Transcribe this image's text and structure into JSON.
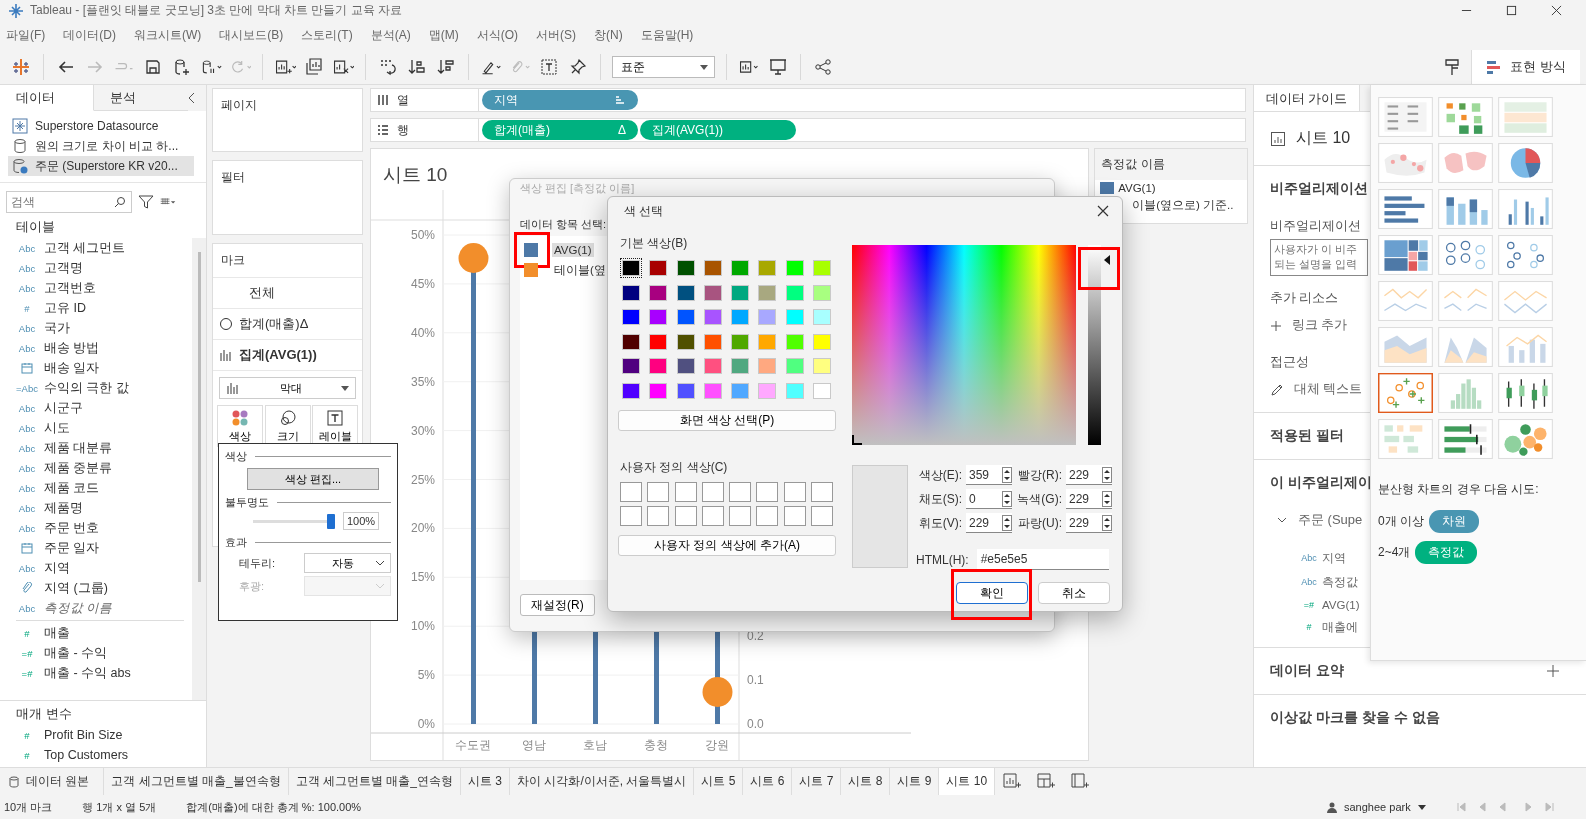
{
  "window": {
    "title": "Tableau - [플랜잇 태블로 굿모닝] 3초 만에 막대 차트 만들기 교육 자료"
  },
  "menu": [
    "파일(F)",
    "데이터(D)",
    "워크시트(W)",
    "대시보드(B)",
    "스토리(T)",
    "분석(A)",
    "맵(M)",
    "서식(O)",
    "서버(S)",
    "창(N)",
    "도움말(H)"
  ],
  "toolbar": {
    "fit_dropdown": "표준",
    "show_me_button": "표현 방식"
  },
  "data_pane": {
    "tabs": [
      {
        "label": "데이터",
        "selected": true
      },
      {
        "label": "분석",
        "selected": false
      }
    ],
    "sources": [
      {
        "kind": "extract",
        "label": "Superstore Datasource",
        "selected": false
      },
      {
        "kind": "database",
        "label": "원의 크기로 차이 비교 하...",
        "selected": false
      },
      {
        "kind": "primary",
        "label": "주문 (Superstore KR v20...",
        "selected": true
      }
    ],
    "search": {
      "placeholder": "검색"
    },
    "table_heading": "테이블",
    "fields": [
      {
        "kind": "badge",
        "badge": "Abc",
        "measure": false,
        "name": "고객 세그먼트",
        "italic": false
      },
      {
        "kind": "badge",
        "badge": "Abc",
        "measure": false,
        "name": "고객명",
        "italic": false
      },
      {
        "kind": "badge",
        "badge": "Abc",
        "measure": false,
        "name": "고객번호",
        "italic": false
      },
      {
        "kind": "badge",
        "badge": "#",
        "measure": false,
        "name": "고유 ID",
        "italic": false
      },
      {
        "kind": "badge",
        "badge": "Abc",
        "measure": false,
        "name": "국가",
        "italic": false
      },
      {
        "kind": "badge",
        "badge": "Abc",
        "measure": false,
        "name": "배송 방법",
        "italic": false
      },
      {
        "kind": "date",
        "measure": false,
        "name": "배송 일자",
        "italic": false
      },
      {
        "kind": "badge",
        "badge": "=Abc",
        "measure": false,
        "name": "수익의 극한 값",
        "italic": false
      },
      {
        "kind": "badge",
        "badge": "Abc",
        "measure": false,
        "name": "시군구",
        "italic": false
      },
      {
        "kind": "badge",
        "badge": "Abc",
        "measure": false,
        "name": "시도",
        "italic": false
      },
      {
        "kind": "badge",
        "badge": "Abc",
        "measure": false,
        "name": "제품 대분류",
        "italic": false
      },
      {
        "kind": "badge",
        "badge": "Abc",
        "measure": false,
        "name": "제품 중분류",
        "italic": false
      },
      {
        "kind": "badge",
        "badge": "Abc",
        "measure": false,
        "name": "제품 코드",
        "italic": false
      },
      {
        "kind": "badge",
        "badge": "Abc",
        "measure": false,
        "name": "제품명",
        "italic": false
      },
      {
        "kind": "badge",
        "badge": "Abc",
        "measure": false,
        "name": "주문 번호",
        "italic": false
      },
      {
        "kind": "date",
        "measure": false,
        "name": "주문 일자",
        "italic": false
      },
      {
        "kind": "badge",
        "badge": "Abc",
        "measure": false,
        "name": "지역",
        "italic": false
      },
      {
        "kind": "group",
        "measure": false,
        "name": "지역 (그룹)",
        "italic": false
      },
      {
        "kind": "badge",
        "badge": "Abc",
        "measure": false,
        "name": "측정값 이름",
        "italic": true
      }
    ],
    "measures": [
      {
        "kind": "badge",
        "badge": "#",
        "measure": true,
        "name": "매출",
        "italic": false
      },
      {
        "kind": "badge",
        "badge": "=#",
        "measure": true,
        "name": "매출 - 수익",
        "italic": false
      },
      {
        "kind": "badge",
        "badge": "=#",
        "measure": true,
        "name": "매출 - 수익 abs",
        "italic": false
      }
    ],
    "parameters_heading": "매개 변수",
    "parameters": [
      {
        "kind": "badge",
        "badge": "#",
        "measure": true,
        "name": "Profit Bin Size",
        "italic": false
      },
      {
        "kind": "badge",
        "badge": "#",
        "measure": true,
        "name": "Top Customers",
        "italic": false
      }
    ]
  },
  "shelves": {
    "pages": "페이지",
    "filters": "필터",
    "marks": {
      "title": "마크",
      "all": "전체",
      "layers": [
        {
          "kind": "circle",
          "label": "합계(매출)",
          "suffix": "Δ",
          "selected": false
        },
        {
          "kind": "bar",
          "label": "집계(AVG(1))",
          "selected": true
        }
      ],
      "mark_type": "막대",
      "buttons": [
        {
          "kind": "color",
          "label": "색상"
        },
        {
          "kind": "size",
          "label": "크기"
        },
        {
          "kind": "label",
          "label": "레이블"
        }
      ]
    }
  },
  "color_popup": {
    "section": "색상",
    "edit_button": "색상 편집...",
    "opacity_label": "불투명도",
    "level": 1.0,
    "opacity_value": "100%",
    "effects_label": "효과",
    "border_label": "테두리:",
    "border_value": "자동",
    "halo_label": "후광:",
    "halo_disabled": true
  },
  "columns_shelf": {
    "label": "열",
    "pills": [
      {
        "label": "지역",
        "color": "#4996b2",
        "sorted": true
      }
    ]
  },
  "rows_shelf": {
    "label": "행",
    "pills": [
      {
        "label": "합계(매출)",
        "color": "#00b180",
        "marker": "Δ"
      },
      {
        "label": "집계(AVG(1))",
        "color": "#00b180"
      }
    ]
  },
  "sheet": {
    "title": "시트 10",
    "y_ticks": [
      "50%",
      "45%",
      "40%",
      "35%",
      "30%",
      "25%",
      "20%",
      "15%",
      "10%",
      "5%",
      "0%"
    ],
    "right_ticks": [
      "0.2",
      "0.1",
      "0.0"
    ],
    "categories": [
      "수도권",
      "영남",
      "호남",
      "충청",
      "강원"
    ]
  },
  "legend": {
    "title": "측정값 이름",
    "items": [
      {
        "label": "AVG(1)",
        "color": "#4e79a7"
      },
      {
        "label": "이블(옆으로) 기준.."
      }
    ]
  },
  "edit_color_dialog": {
    "title": "색상 편집 [측정값 이름]",
    "list_label": "데이터 항목 선택:",
    "items": [
      {
        "label": "AVG(1)",
        "color": "#4e79a7",
        "selected": true,
        "highlighted": true
      },
      {
        "label": "테이블(옆",
        "color": "#f28e2b",
        "selected": false,
        "highlighted": false
      }
    ],
    "reset_button": "재설정(R)"
  },
  "color_picker": {
    "title": "색 선택",
    "basic_label": "기본 색상(B)",
    "swatches": [
      {
        "color": "#000000",
        "selected": true
      },
      {
        "color": "#a80000",
        "selected": false
      },
      {
        "color": "#005000",
        "selected": false
      },
      {
        "color": "#a85400",
        "selected": false
      },
      {
        "color": "#00a800",
        "selected": false
      },
      {
        "color": "#a8a800",
        "selected": false
      },
      {
        "color": "#00ff00",
        "selected": false
      },
      {
        "color": "#a8ff00",
        "selected": false
      },
      {
        "color": "#000080",
        "selected": false
      },
      {
        "color": "#a80080",
        "selected": false
      },
      {
        "color": "#005080",
        "selected": false
      },
      {
        "color": "#a85480",
        "selected": false
      },
      {
        "color": "#00a880",
        "selected": false
      },
      {
        "color": "#a8a880",
        "selected": false
      },
      {
        "color": "#00ff80",
        "selected": false
      },
      {
        "color": "#a8ff80",
        "selected": false
      },
      {
        "color": "#0000ff",
        "selected": false
      },
      {
        "color": "#a800ff",
        "selected": false
      },
      {
        "color": "#0054ff",
        "selected": false
      },
      {
        "color": "#a854ff",
        "selected": false
      },
      {
        "color": "#00a8ff",
        "selected": false
      },
      {
        "color": "#a8a8ff",
        "selected": false
      },
      {
        "color": "#00ffff",
        "selected": false
      },
      {
        "color": "#a8ffff",
        "selected": false
      },
      {
        "color": "#500000",
        "selected": false
      },
      {
        "color": "#ff0000",
        "selected": false
      },
      {
        "color": "#505000",
        "selected": false
      },
      {
        "color": "#ff5000",
        "selected": false
      },
      {
        "color": "#50a800",
        "selected": false
      },
      {
        "color": "#ffa800",
        "selected": false
      },
      {
        "color": "#50ff00",
        "selected": false
      },
      {
        "color": "#ffff00",
        "selected": false
      },
      {
        "color": "#500080",
        "selected": false
      },
      {
        "color": "#ff0080",
        "selected": false
      },
      {
        "color": "#505080",
        "selected": false
      },
      {
        "color": "#ff5080",
        "selected": false
      },
      {
        "color": "#50a880",
        "selected": false
      },
      {
        "color": "#ffa880",
        "selected": false
      },
      {
        "color": "#50ff80",
        "selected": false
      },
      {
        "color": "#ffff80",
        "selected": false
      },
      {
        "color": "#5000ff",
        "selected": false
      },
      {
        "color": "#ff00ff",
        "selected": false
      },
      {
        "color": "#5050ff",
        "selected": false
      },
      {
        "color": "#ff50ff",
        "selected": false
      },
      {
        "color": "#50a8ff",
        "selected": false
      },
      {
        "color": "#ffa8ff",
        "selected": false
      },
      {
        "color": "#50ffff",
        "selected": false
      },
      {
        "color": "#ffffff",
        "selected": false
      }
    ],
    "pick_button": "화면 색상 선택(P)",
    "custom_label": "사용자 정의 색상(C)",
    "add_button": "사용자 정의 색상에 추가(A)",
    "luminance": {
      "level": 0.95,
      "highlighted": true
    },
    "fields": [
      {
        "label": "색상(E):",
        "value": "359"
      },
      {
        "label": "빨강(R):",
        "value": "229"
      },
      {
        "label": "채도(S):",
        "value": "0"
      },
      {
        "label": "녹색(G):",
        "value": "229"
      },
      {
        "label": "휘도(V):",
        "value": "229"
      },
      {
        "label": "파랑(U):",
        "value": "229"
      }
    ],
    "html_label": "HTML(H):",
    "html_value": "#e5e5e5",
    "ok_button": "확인",
    "ok_highlighted": true,
    "cancel_button": "취소"
  },
  "data_guide": {
    "tab": "데이터 가이드",
    "sheet": "시트 10",
    "viz_heading": "비주얼리제이션",
    "desc_label": "비주얼리제이션",
    "desc_placeholder": "사용자가 이 비주\n되는 설명을 입력",
    "resources": "추가 리소스",
    "add_link": "링크 추가",
    "accessibility": "접근성",
    "alt_text": "대체 텍스트",
    "filters": "적용된 필터",
    "fields_heading": "이 비주얼리제이",
    "tree": {
      "label": "주문 (Supe",
      "expanded": true,
      "children": [
        {
          "kind": "badge",
          "badge": "Abc",
          "measure": false,
          "name": "지역"
        },
        {
          "kind": "badge",
          "badge": "Abc",
          "measure": false,
          "name": "측정값"
        },
        {
          "kind": "badge",
          "badge": "=#",
          "measure": true,
          "name": "AVG(1)"
        },
        {
          "kind": "badge",
          "badge": "#",
          "measure": true,
          "name": "매출에"
        }
      ]
    },
    "summary": "데이터 요약",
    "outliers": "이상값 마크를 찾을 수 없음"
  },
  "show_me": {
    "thumbnails": [
      {
        "kind": "text-table",
        "selected": false
      },
      {
        "kind": "heat-map",
        "selected": false
      },
      {
        "kind": "highlight-table",
        "selected": false
      },
      {
        "kind": "symbol-map",
        "selected": false
      },
      {
        "kind": "filled-map",
        "selected": false
      },
      {
        "kind": "pie",
        "selected": false
      },
      {
        "kind": "hbar",
        "selected": false
      },
      {
        "kind": "stacked-bar",
        "selected": false
      },
      {
        "kind": "side-bar",
        "selected": false
      },
      {
        "kind": "treemap",
        "selected": false
      },
      {
        "kind": "circles",
        "selected": false
      },
      {
        "kind": "side-circles",
        "selected": false
      },
      {
        "kind": "line",
        "selected": false
      },
      {
        "kind": "line-split",
        "selected": false
      },
      {
        "kind": "dual-line",
        "selected": false
      },
      {
        "kind": "area",
        "selected": false
      },
      {
        "kind": "area-split",
        "selected": false
      },
      {
        "kind": "combo",
        "selected": false
      },
      {
        "kind": "scatter",
        "selected": true
      },
      {
        "kind": "histogram",
        "selected": false
      },
      {
        "kind": "box-plot",
        "selected": false
      },
      {
        "kind": "gantt",
        "selected": false
      },
      {
        "kind": "bullet",
        "selected": false
      },
      {
        "kind": "bubbles",
        "selected": false
      }
    ],
    "hint": "분산형 차트의 경우 다음 시도:",
    "requirements": [
      {
        "count": "0개 이상",
        "pill": "차원",
        "color": "#4996b2"
      },
      {
        "count": "2~4개",
        "pill": "측정값",
        "color": "#00b180"
      }
    ]
  },
  "sheet_tabs": {
    "data_source": "데이터 원본",
    "tabs": [
      {
        "label": "고객 세그먼트별 매출_불연속형",
        "selected": false
      },
      {
        "label": "고객 세그먼트별 매출_연속형",
        "selected": false
      },
      {
        "label": "시트 3",
        "selected": false
      },
      {
        "label": "차이 시각화/이서준, 서울특별시",
        "selected": false
      },
      {
        "label": "시트 5",
        "selected": false
      },
      {
        "label": "시트 6",
        "selected": false
      },
      {
        "label": "시트 7",
        "selected": false
      },
      {
        "label": "시트 8",
        "selected": false
      },
      {
        "label": "시트 9",
        "selected": false
      },
      {
        "label": "시트 10",
        "selected": true
      }
    ]
  },
  "status_bar": {
    "marks": "10개 마크",
    "dims": "행 1개 x 열 5개",
    "total": "합계(매출)에 대한 총계 %: 100.00%",
    "user": "sanghee park"
  }
}
